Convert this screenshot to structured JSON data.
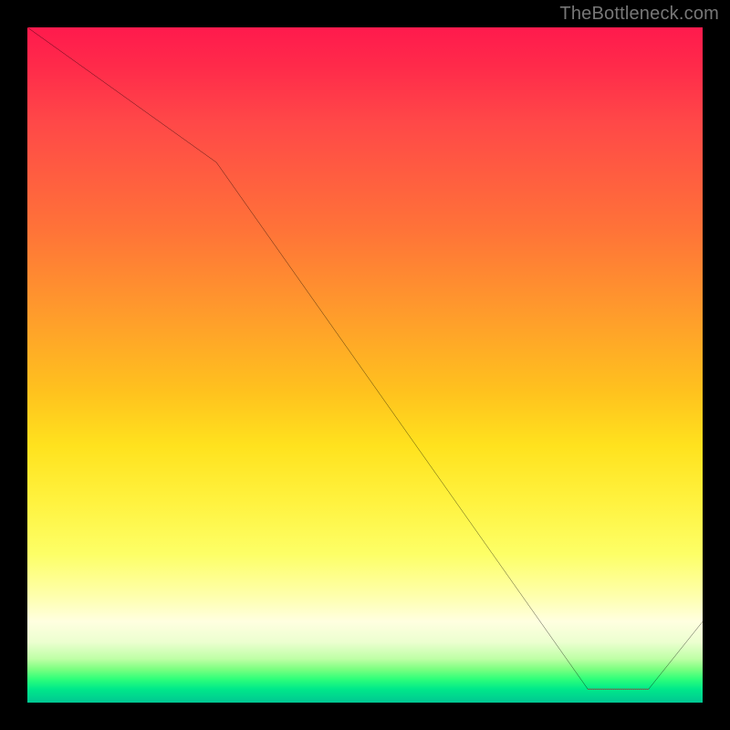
{
  "attribution": "TheBottleneck.com",
  "chart_data": {
    "type": "line",
    "title": "",
    "xlabel": "",
    "ylabel": "",
    "xlim": [
      0,
      100
    ],
    "ylim": [
      0,
      100
    ],
    "x": [
      0,
      28,
      83,
      92,
      100
    ],
    "values": [
      100,
      80,
      2,
      2,
      12
    ],
    "annotation_segment": {
      "x0": 83,
      "x1": 92,
      "y": 2,
      "style": "red-dotted"
    }
  }
}
